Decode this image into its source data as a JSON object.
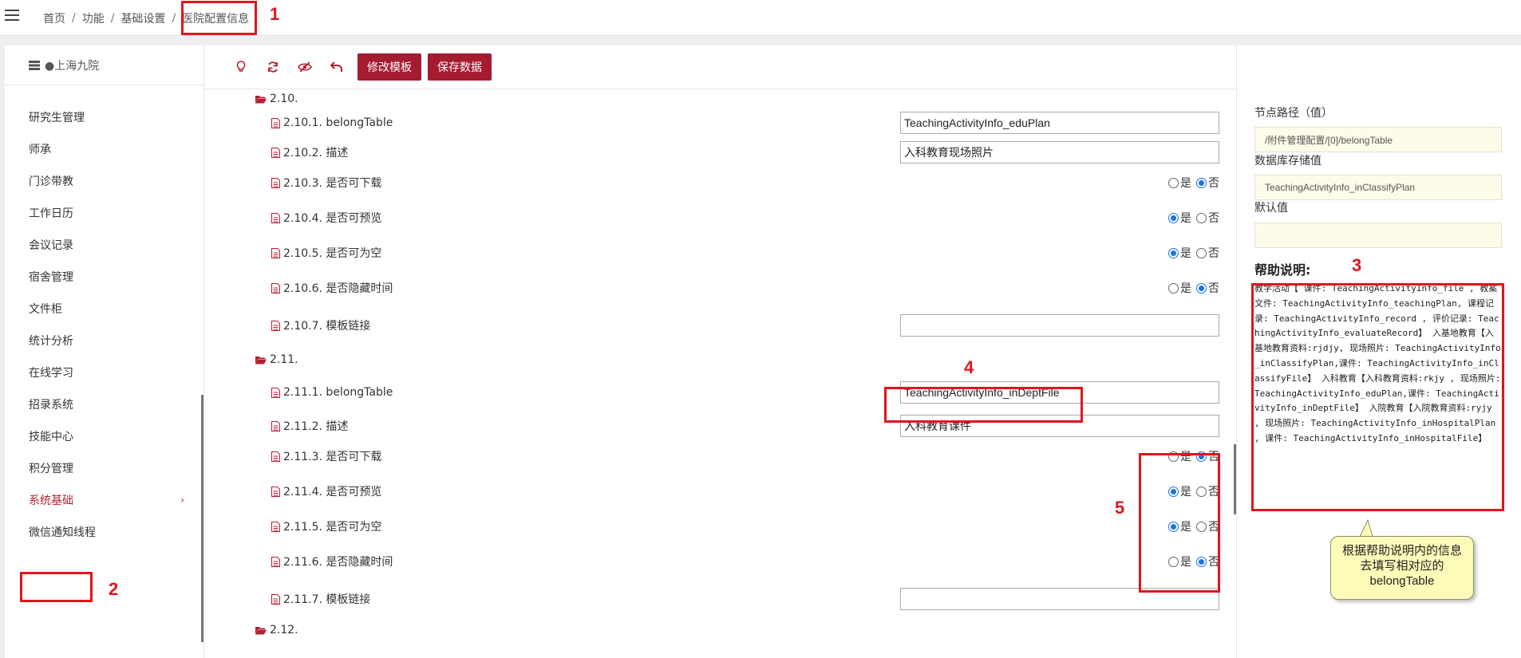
{
  "breadcrumb": {
    "home": "首页",
    "func": "功能",
    "basic": "基础设置",
    "current": "医院配置信息",
    "sep": "/"
  },
  "sidebar": {
    "hospital": "●上海九院",
    "items": [
      {
        "label": "研究生管理"
      },
      {
        "label": "师承"
      },
      {
        "label": "门诊带教"
      },
      {
        "label": "工作日历"
      },
      {
        "label": "会议记录"
      },
      {
        "label": "宿舍管理"
      },
      {
        "label": "文件柜"
      },
      {
        "label": "统计分析"
      },
      {
        "label": "在线学习"
      },
      {
        "label": "招录系统"
      },
      {
        "label": "技能中心"
      },
      {
        "label": "积分管理"
      },
      {
        "label": "系统基础"
      },
      {
        "label": "微信通知线程"
      }
    ],
    "chevron": "›"
  },
  "toolbar": {
    "edit_template": "修改模板",
    "save_data": "保存数据"
  },
  "tree": {
    "nodes": [
      {
        "label": "2.10."
      },
      {
        "label": "2.10.1. belongTable",
        "value": "TeachingActivityInfo_eduPlan"
      },
      {
        "label": "2.10.2. 描述",
        "value": "入科教育现场照片"
      },
      {
        "label": "2.10.3. 是否可下载",
        "yes": "是",
        "no": "否"
      },
      {
        "label": "2.10.4. 是否可预览",
        "yes": "是",
        "no": "否"
      },
      {
        "label": "2.10.5. 是否可为空",
        "yes": "是",
        "no": "否"
      },
      {
        "label": "2.10.6. 是否隐藏时间",
        "yes": "是",
        "no": "否"
      },
      {
        "label": "2.10.7. 模板链接",
        "value": ""
      },
      {
        "label": "2.11."
      },
      {
        "label": "2.11.1. belongTable",
        "value": "TeachingActivityInfo_inDeptFile"
      },
      {
        "label": "2.11.2. 描述",
        "value": "入科教育课件"
      },
      {
        "label": "2.11.3. 是否可下载",
        "yes": "是",
        "no": "否"
      },
      {
        "label": "2.11.4. 是否可预览",
        "yes": "是",
        "no": "否"
      },
      {
        "label": "2.11.5. 是否可为空",
        "yes": "是",
        "no": "否"
      },
      {
        "label": "2.11.6. 是否隐藏时间",
        "yes": "是",
        "no": "否"
      },
      {
        "label": "2.11.7. 模板链接",
        "value": ""
      },
      {
        "label": "2.12."
      }
    ]
  },
  "right_panel": {
    "node_path_label": "节点路径（值）",
    "node_path_value": "/附件管理配置/[0]/belongTable",
    "db_value_label": "数据库存储值",
    "db_value": "TeachingActivityInfo_inClassifyPlan",
    "default_label": "默认值",
    "default_value": "",
    "help_title": "帮助说明:",
    "help_text": "教学活动【 课件: TeachingActivityInfo_file , 教案文件: TeachingActivityInfo_teachingPlan, 课程记录: TeachingActivityInfo_record , 评价记录: TeachingActivityInfo_evaluateRecord】 入基地教育【入基地教育资料:rjdjy, 现场照片: TeachingActivityInfo_inClassifyPlan,课件: TeachingActivityInfo_inClassifyFile】 入科教育【入科教育资料:rkjy , 现场照片: TeachingActivityInfo_eduPlan,课件: TeachingActivityInfo_inDeptFile】 入院教育【入院教育资料:ryjy , 现场照片: TeachingActivityInfo_inHospitalPlan , 课件: TeachingActivityInfo_inHospitalFile】"
  },
  "annotations": {
    "n1": "1",
    "n2": "2",
    "n3": "3",
    "n4": "4",
    "n5": "5"
  },
  "callout": {
    "text": "根据帮助说明内的信息去填写相对应的belongTable"
  },
  "colors": {
    "accent": "#a51b30",
    "annotation": "#e2141c",
    "radio": "#1a73e8"
  }
}
